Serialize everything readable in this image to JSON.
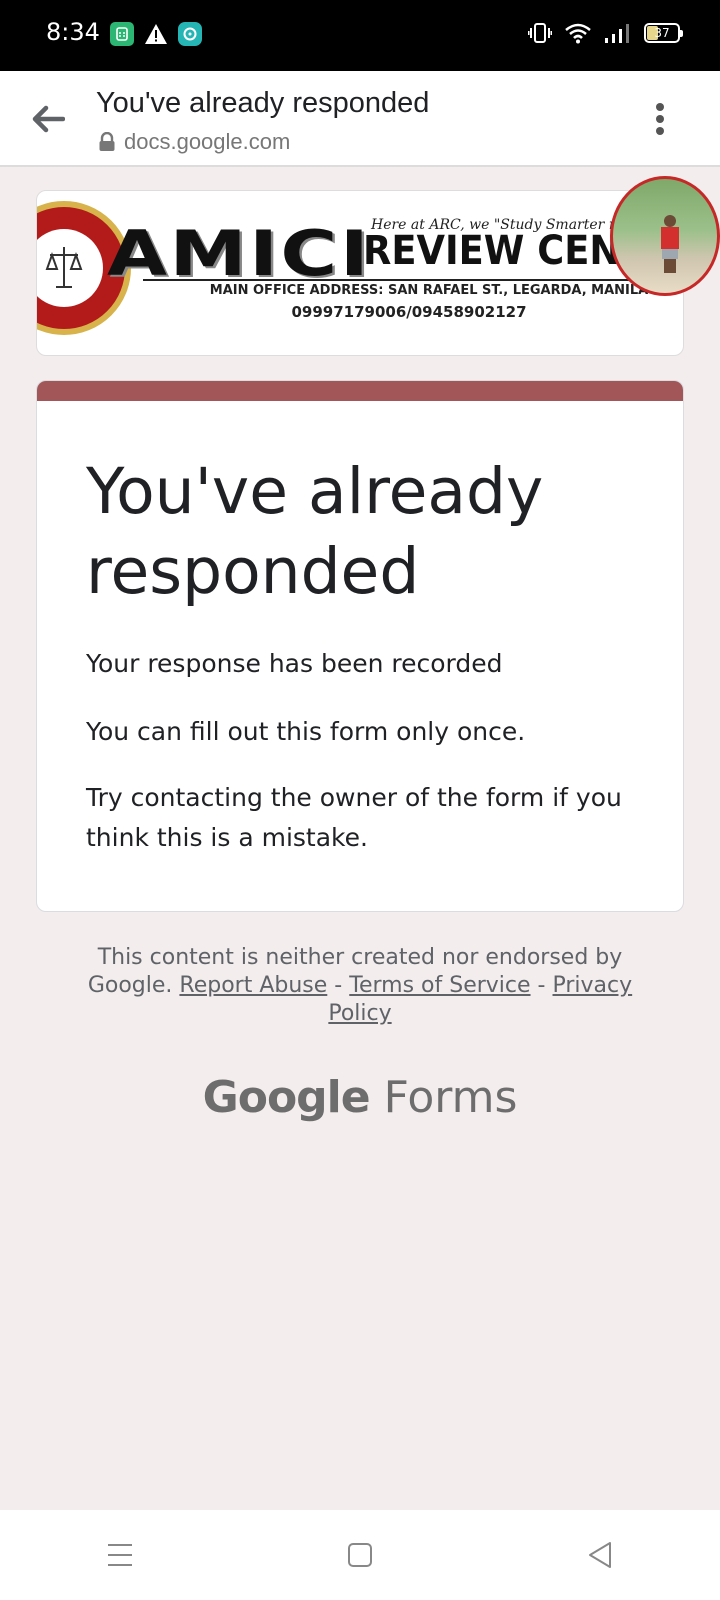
{
  "status_bar": {
    "time": "8:34",
    "battery": "37"
  },
  "browser": {
    "title": "You've already responded",
    "url": "docs.google.com"
  },
  "banner": {
    "logo_primary": "AMICI",
    "logo_secondary": "REVIEW CENT",
    "tagline": "Here at ARC, we \"Study Smarter not",
    "address": "MAIN OFFICE ADDRESS: SAN RAFAEL ST., LEGARDA, MANILA",
    "phone": "09997179006/09458902127"
  },
  "card": {
    "title": "You've already responded",
    "line1": "Your response has been recorded",
    "line2": "You can fill out this form only once.",
    "line3": "Try contacting the owner of the form if you think this is a mistake."
  },
  "footer": {
    "disclaimer": "This content is neither created nor endorsed by Google.",
    "report_abuse": "Report Abuse",
    "terms": "Terms of Service",
    "privacy": "Privacy Policy",
    "separator": "-",
    "brand_google": "Google",
    "brand_forms": "Forms"
  },
  "colors": {
    "accent": "#a25658",
    "background": "#f3eded"
  }
}
